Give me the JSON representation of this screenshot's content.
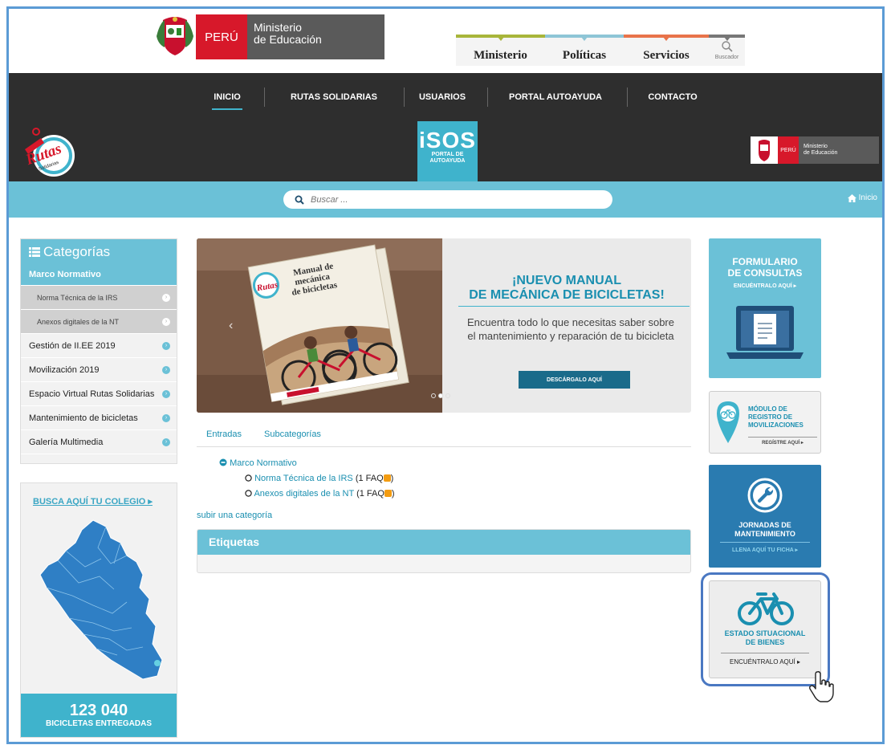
{
  "header": {
    "peru_label": "PERÚ",
    "ministry_line1": "Ministerio",
    "ministry_line2": "de Educación",
    "tabs": [
      {
        "label": "Ministerio",
        "color": "#a8b53a"
      },
      {
        "label": "Políticas",
        "color": "#8ec5d6"
      },
      {
        "label": "Servicios",
        "color": "#e8734a"
      }
    ],
    "search_tab_label": "Buscador",
    "search_icon": "magnifier-icon"
  },
  "nav": {
    "items": [
      "INICIO",
      "RUTAS SOLIDARIAS",
      "USUARIOS",
      "PORTAL AUTOAYUDA",
      "CONTACTO"
    ],
    "active": "INICIO"
  },
  "banner": {
    "logo_text": "Rutas",
    "logo_sub": "Solidarias",
    "isos_big": "iSOS",
    "isos_small_1": "PORTAL DE",
    "isos_small_2": "AUTOAYUDA",
    "minedu_peru": "PERÚ",
    "minedu_line1": "Ministerio",
    "minedu_line2": "de Educación"
  },
  "search": {
    "placeholder": "Buscar ...",
    "home_label": "Inicio"
  },
  "categories": {
    "title": "Categorías",
    "items": [
      {
        "label": "Marco Normativo",
        "state": "active"
      },
      {
        "label": "Norma Técnica de la IRS",
        "state": "sub"
      },
      {
        "label": "Anexos digitales de la NT",
        "state": "sub"
      },
      {
        "label": "Gestión de II.EE 2019",
        "state": "normal"
      },
      {
        "label": "Movilización 2019",
        "state": "normal"
      },
      {
        "label": "Espacio Virtual Rutas Solidarias",
        "state": "normal"
      },
      {
        "label": "Mantenimiento de bicicletas",
        "state": "normal"
      },
      {
        "label": "Galería Multimedia",
        "state": "normal"
      }
    ]
  },
  "colegio": {
    "link": "BUSCA AQUÍ TU COLEGIO ▸",
    "count": "123 040",
    "count_label": "BICICLETAS ENTREGADAS"
  },
  "slider": {
    "book_title_1": "Manual de",
    "book_title_2": "mecánica",
    "book_title_3": "de bicicletas",
    "heading_1": "¡NUEVO MANUAL",
    "heading_2": "DE MECÁNICA DE BICICLETAS!",
    "body": "Encuentra todo lo que necesitas saber sobre el mantenimiento y reparación de tu bicicleta",
    "cta": "DESCÁRGALO AQUÍ",
    "prev": "‹",
    "next": "›",
    "active_slide": 2,
    "slide_count": 3
  },
  "content_tabs": [
    "Entradas",
    "Subcategorías"
  ],
  "tree": {
    "root": "Marco Normativo",
    "children": [
      {
        "label": "Norma Técnica de la IRS",
        "count": "(1 FAQ"
      },
      {
        "label": "Anexos digitales de la NT",
        "count": "(1 FAQ"
      }
    ],
    "up_link": "subir una categoría"
  },
  "etiquetas": {
    "title": "Etiquetas"
  },
  "right": {
    "formulario_1": "FORMULARIO",
    "formulario_2": "DE CONSULTAS",
    "formulario_sub": "ENCUÉNTRALO AQUÍ ▸",
    "modulo_1": "MÓDULO DE",
    "modulo_2": "REGISTRO DE",
    "modulo_3": "MOVILIZACIONES",
    "modulo_sub": "REGÍSTRE AQUÍ ▸",
    "jornadas_1": "JORNADAS DE",
    "jornadas_2": "MANTENIMIENTO",
    "jornadas_sub": "LLENA AQUÍ TU FICHA ▸",
    "estado_1": "ESTADO SITUACIONAL",
    "estado_2": "DE BIENES",
    "estado_sub": "ENCUÉNTRALO AQUÍ ▸"
  },
  "colors": {
    "accent": "#6bc1d7",
    "dark_nav": "#2e2e2e",
    "peru_red": "#d7182a",
    "jornadas_blue": "#2a7bb0",
    "highlight_outline": "#4a78c2"
  }
}
